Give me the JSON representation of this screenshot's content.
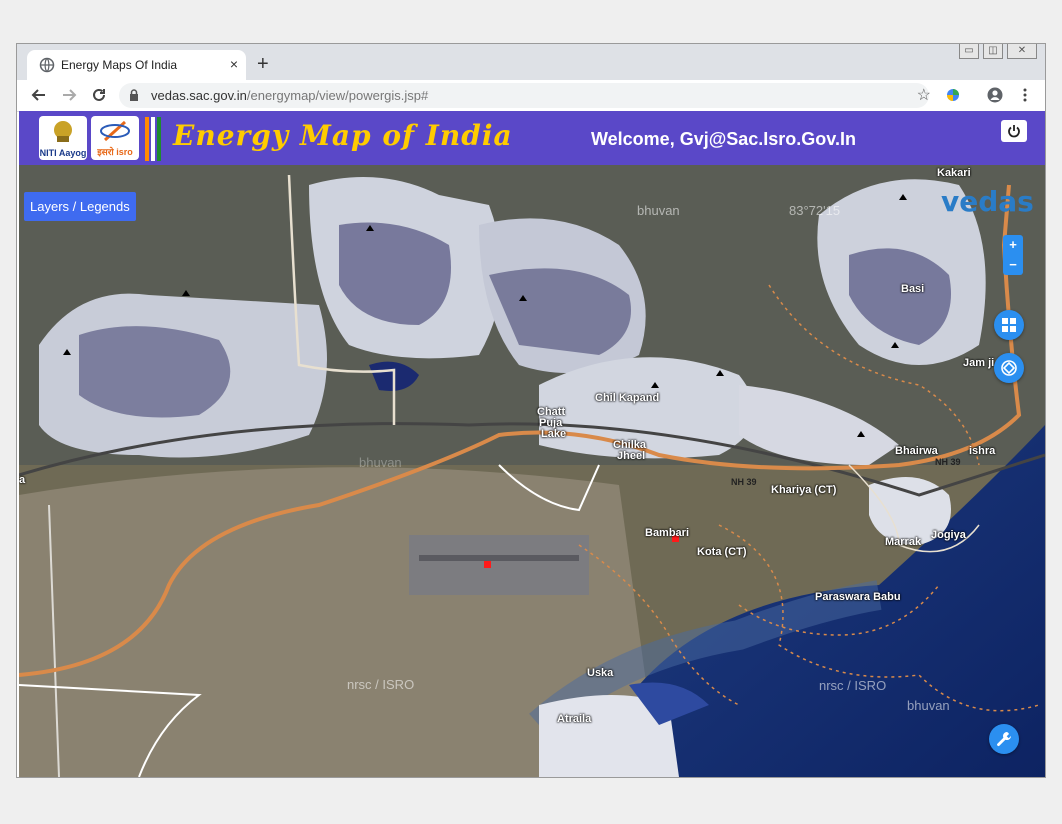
{
  "browser": {
    "tab_title": "Energy Maps Of India",
    "tab_close": "×",
    "new_tab": "+",
    "url_domain": "vedas.sac.gov.in",
    "url_path": "/energymap/view/powergis.jsp#",
    "window_controls": [
      "▭",
      "◫",
      "✕"
    ]
  },
  "header": {
    "logo1_text": "NITI Aayog",
    "logo2_text": "इसरो isro",
    "title": "Energy Map of India",
    "welcome": "Welcome, Gvj@Sac.Isro.Gov.In",
    "colors": {
      "bar": "#5a48c8",
      "title": "#ffcc00"
    }
  },
  "map": {
    "layers_button": "Layers / Legends",
    "zoom_in": "+",
    "zoom_out": "−",
    "brand_logo": "vedas",
    "watermarks": [
      "bhuvan",
      "nrsc / ISRO",
      "bhuvan",
      "nrsc / ISRO",
      "bhuvan",
      "83°72'15"
    ],
    "places": [
      "Kakari",
      "Basi",
      "Jam ji (CT)",
      "Chil Kapand",
      "Chatt",
      "Puja",
      "Lake",
      "Chilka",
      "Jheel",
      "Bhairwa",
      "ishra",
      "NH 39",
      "NH 39",
      "Khariya (CT)",
      "Bambari",
      "Kota (CT)",
      "Marrak",
      "Jogiya",
      "Paraswara Babu",
      "Uska",
      "Atraila",
      "a"
    ]
  },
  "icons": [
    "globe-icon",
    "back-arrow-icon",
    "forward-arrow-icon",
    "reload-icon",
    "lock-icon",
    "star-icon",
    "extension-icon",
    "account-icon",
    "menu-icon",
    "power-icon",
    "apps-grid-icon",
    "locate-icon",
    "wrench-icon"
  ]
}
